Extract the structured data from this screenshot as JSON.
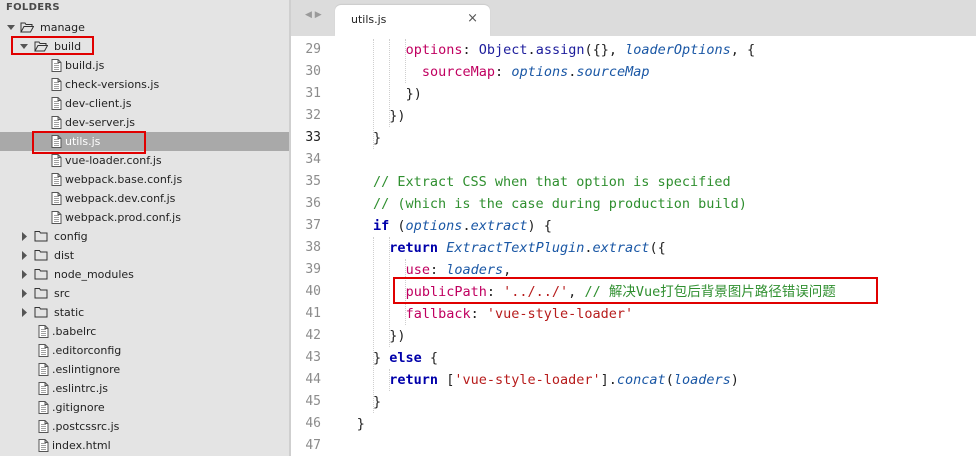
{
  "sidebar": {
    "title": "FOLDERS",
    "items": [
      {
        "label": "manage",
        "type": "folder",
        "open": true
      },
      {
        "label": "build",
        "type": "folder",
        "open": true
      },
      {
        "label": "build.js",
        "type": "file"
      },
      {
        "label": "check-versions.js",
        "type": "file"
      },
      {
        "label": "dev-client.js",
        "type": "file"
      },
      {
        "label": "dev-server.js",
        "type": "file"
      },
      {
        "label": "utils.js",
        "type": "file",
        "selected": true
      },
      {
        "label": "vue-loader.conf.js",
        "type": "file"
      },
      {
        "label": "webpack.base.conf.js",
        "type": "file"
      },
      {
        "label": "webpack.dev.conf.js",
        "type": "file"
      },
      {
        "label": "webpack.prod.conf.js",
        "type": "file"
      },
      {
        "label": "config",
        "type": "folder",
        "open": false
      },
      {
        "label": "dist",
        "type": "folder",
        "open": false
      },
      {
        "label": "node_modules",
        "type": "folder",
        "open": false
      },
      {
        "label": "src",
        "type": "folder",
        "open": false
      },
      {
        "label": "static",
        "type": "folder",
        "open": false
      },
      {
        "label": ".babelrc",
        "type": "file"
      },
      {
        "label": ".editorconfig",
        "type": "file"
      },
      {
        "label": ".eslintignore",
        "type": "file"
      },
      {
        "label": ".eslintrc.js",
        "type": "file"
      },
      {
        "label": ".gitignore",
        "type": "file"
      },
      {
        "label": ".postcssrc.js",
        "type": "file"
      },
      {
        "label": "index.html",
        "type": "file"
      }
    ]
  },
  "editor": {
    "nav_arrows": "◀ ▶",
    "tab": {
      "title": "utils.js",
      "close": "×"
    },
    "current_line": 33,
    "lines": [
      {
        "n": "29",
        "indent": 2,
        "tokens": [
          [
            "p",
            "options"
          ],
          [
            "d",
            ": "
          ],
          [
            "o",
            "Object"
          ],
          [
            "d",
            "."
          ],
          [
            "o",
            "assign"
          ],
          [
            "d",
            "({}, "
          ],
          [
            "t",
            "loaderOptions"
          ],
          [
            "d",
            ", {"
          ]
        ]
      },
      {
        "n": "30",
        "indent": 3,
        "tokens": [
          [
            "p",
            "sourceMap"
          ],
          [
            "d",
            ": "
          ],
          [
            "t",
            "options"
          ],
          [
            "d",
            "."
          ],
          [
            "t",
            "sourceMap"
          ]
        ]
      },
      {
        "n": "31",
        "indent": 2,
        "tokens": [
          [
            "d",
            "})"
          ]
        ]
      },
      {
        "n": "32",
        "indent": 1,
        "tokens": [
          [
            "d",
            "})"
          ]
        ]
      },
      {
        "n": "33",
        "indent": 0,
        "tokens": [
          [
            "d",
            "}"
          ]
        ]
      },
      {
        "n": "34",
        "indent": 0,
        "tokens": []
      },
      {
        "n": "35",
        "indent": 0,
        "tokens": [
          [
            "c",
            "// Extract CSS when that option is specified"
          ]
        ]
      },
      {
        "n": "36",
        "indent": 0,
        "tokens": [
          [
            "c",
            "// (which is the case during production build)"
          ]
        ]
      },
      {
        "n": "37",
        "indent": 0,
        "tokens": [
          [
            "k",
            "if"
          ],
          [
            "d",
            " ("
          ],
          [
            "t",
            "options"
          ],
          [
            "d",
            "."
          ],
          [
            "t",
            "extract"
          ],
          [
            "d",
            ") {"
          ]
        ]
      },
      {
        "n": "38",
        "indent": 1,
        "tokens": [
          [
            "k",
            "return"
          ],
          [
            "d",
            " "
          ],
          [
            "t",
            "ExtractTextPlugin"
          ],
          [
            "d",
            "."
          ],
          [
            "t",
            "extract"
          ],
          [
            "d",
            "({"
          ]
        ]
      },
      {
        "n": "39",
        "indent": 2,
        "tokens": [
          [
            "p",
            "use"
          ],
          [
            "d",
            ": "
          ],
          [
            "t",
            "loaders"
          ],
          [
            "d",
            ","
          ]
        ]
      },
      {
        "n": "40",
        "indent": 2,
        "tokens": [
          [
            "p",
            "publicPath"
          ],
          [
            "d",
            ": "
          ],
          [
            "s",
            "'../../'"
          ],
          [
            "d",
            ", "
          ],
          [
            "c",
            "// 解决Vue打包后背景图片路径错误问题"
          ]
        ]
      },
      {
        "n": "41",
        "indent": 2,
        "tokens": [
          [
            "p",
            "fallback"
          ],
          [
            "d",
            ": "
          ],
          [
            "s",
            "'vue-style-loader'"
          ]
        ]
      },
      {
        "n": "42",
        "indent": 1,
        "tokens": [
          [
            "d",
            "})"
          ]
        ]
      },
      {
        "n": "43",
        "indent": 0,
        "tokens": [
          [
            "d",
            "} "
          ],
          [
            "k",
            "else"
          ],
          [
            "d",
            " {"
          ]
        ]
      },
      {
        "n": "44",
        "indent": 1,
        "tokens": [
          [
            "k",
            "return"
          ],
          [
            "d",
            " ["
          ],
          [
            "s",
            "'vue-style-loader'"
          ],
          [
            "d",
            "]."
          ],
          [
            "t",
            "concat"
          ],
          [
            "d",
            "("
          ],
          [
            "t",
            "loaders"
          ],
          [
            "d",
            ")"
          ]
        ]
      },
      {
        "n": "45",
        "indent": 0,
        "tokens": [
          [
            "d",
            "}"
          ]
        ]
      },
      {
        "n": "46",
        "indent": -1,
        "tokens": [
          [
            "d",
            "}"
          ]
        ]
      },
      {
        "n": "47",
        "indent": -1,
        "tokens": []
      }
    ]
  },
  "colors": {
    "annotation_box": "#e00000",
    "selected_row": "#a9a9a9",
    "sidebar_bg": "#e4e4e4"
  }
}
